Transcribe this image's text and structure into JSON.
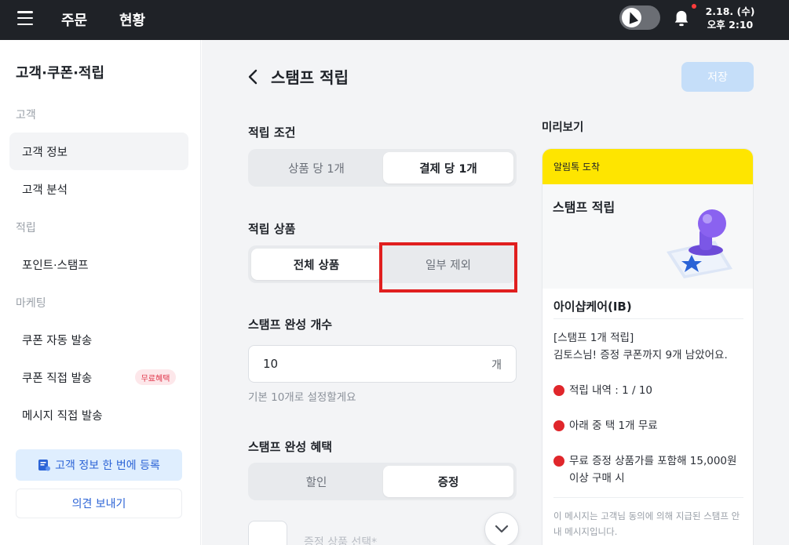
{
  "topbar": {
    "nav_orders": "주문",
    "nav_status": "현황",
    "clock_date": "2.18. (수)",
    "clock_time": "오후 2:10"
  },
  "sidebar": {
    "title": "고객·쿠폰·적립",
    "sections": {
      "customer": "고객",
      "accrual": "적립",
      "marketing": "마케팅"
    },
    "items": {
      "customer_info": "고객 정보",
      "customer_analysis": "고객 분석",
      "points_stamps": "포인트·스탬프",
      "coupon_auto": "쿠폰 자동 발송",
      "coupon_direct": "쿠폰 직접 발송",
      "message_direct": "메시지 직접 발송"
    },
    "free_badge": "무료혜택",
    "register_button": "고객 정보 한 번에 등록",
    "feedback_button": "의견 보내기"
  },
  "main": {
    "page_title": "스탬프 적립",
    "save_button": "저장",
    "accrual_condition": {
      "label": "적립 조건",
      "options": [
        "상품 당 1개",
        "결제 당 1개"
      ]
    },
    "accrual_products": {
      "label": "적립 상품",
      "options": [
        "전체 상품",
        "일부 제외"
      ]
    },
    "completion_count": {
      "label": "스탬프 완성 개수",
      "value": "10",
      "unit": "개",
      "helper": "기본 10개로 설정할게요"
    },
    "completion_benefit": {
      "label": "스탬프 완성 혜택",
      "options": [
        "할인",
        "증정"
      ]
    },
    "gift_product_label": "증정 상품 선택*"
  },
  "preview": {
    "label": "미리보기",
    "header": "알림톡 도착",
    "title": "스탬프 적립",
    "store_name": "아이샵케어(IB)",
    "line1": "[스탬프 1개 적립]",
    "line2": "김토스님! 증정 쿠폰까지 9개 남았어요.",
    "bullet1": "적립 내역 : 1 / 10",
    "bullet2": "아래 중 택 1개 무료",
    "bullet3": "무료 증정 상품가를 포함해 15,000원 이상 구매 시",
    "note": "이 메시지는 고객님 동의에 의해 지급된 스탬프 안내 메시지입니다."
  },
  "colors": {
    "topbar": "#1f2227",
    "accent_blue": "#2b63d6",
    "save_disabled": "#c5def9",
    "kakao_yellow": "#fee500",
    "highlight_red": "#e01f1f"
  }
}
